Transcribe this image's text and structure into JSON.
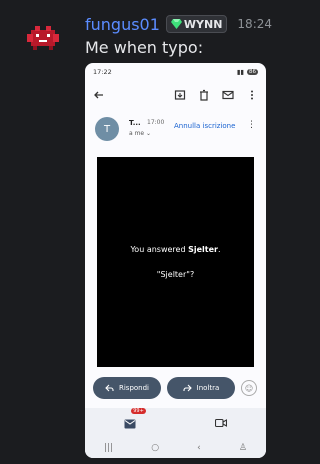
{
  "post": {
    "username": "fungus01",
    "guild_tag": "WYNN",
    "timestamp": "18:24",
    "message": "Me when typo:"
  },
  "phone": {
    "status_time": "17:22",
    "battery": "86",
    "sender_initial": "T",
    "sender_name": "T...",
    "sender_time": "17:00",
    "recipient": "a me",
    "unsubscribe": "Annulla iscrizione",
    "answer_prefix": "You answered ",
    "answer_word": "Sjelter",
    "answer_suffix": ".",
    "question": "\"Sjelter\"?",
    "reply_label": "Rispondi",
    "forward_label": "Inoltra",
    "mail_badge": "99+"
  },
  "colors": {
    "background": "#1b1c1f",
    "username": "#5b8cff",
    "button": "#455569",
    "badge": "#d52c2c"
  }
}
